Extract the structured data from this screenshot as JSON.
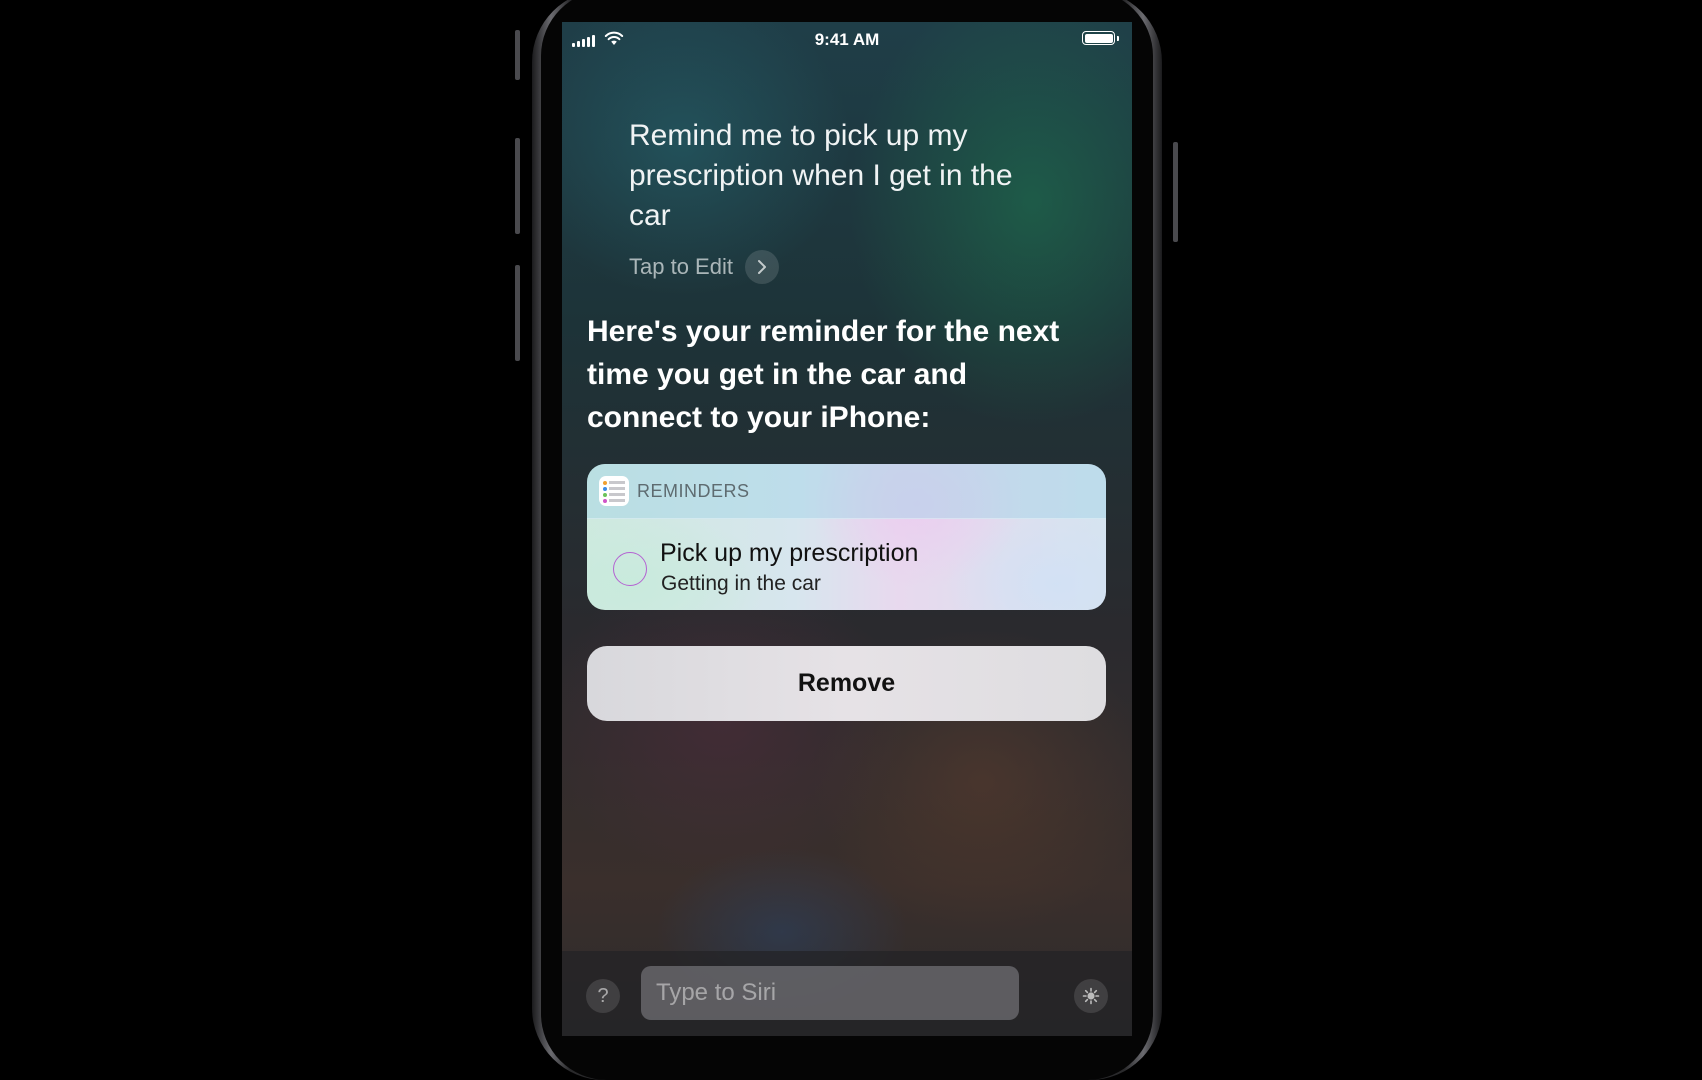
{
  "status_bar": {
    "time": "9:41 AM"
  },
  "siri": {
    "query": "Remind me to pick up my prescription when I get in the car",
    "tap_to_edit": "Tap to Edit",
    "response": "Here's your reminder for the next time you get in the car and connect to your iPhone:"
  },
  "reminder_card": {
    "app_name": "REMINDERS",
    "title": "Pick up my prescription",
    "subtitle": "Getting in the car"
  },
  "remove_button": {
    "label": "Remove"
  },
  "bottom_bar": {
    "help_label": "?",
    "input_placeholder": "Type to Siri"
  },
  "icons": [
    "signal-icon",
    "wifi-icon",
    "battery-icon",
    "chevron-right-icon",
    "reminders-app-icon",
    "checkbox-icon",
    "help-icon",
    "siri-icon"
  ]
}
